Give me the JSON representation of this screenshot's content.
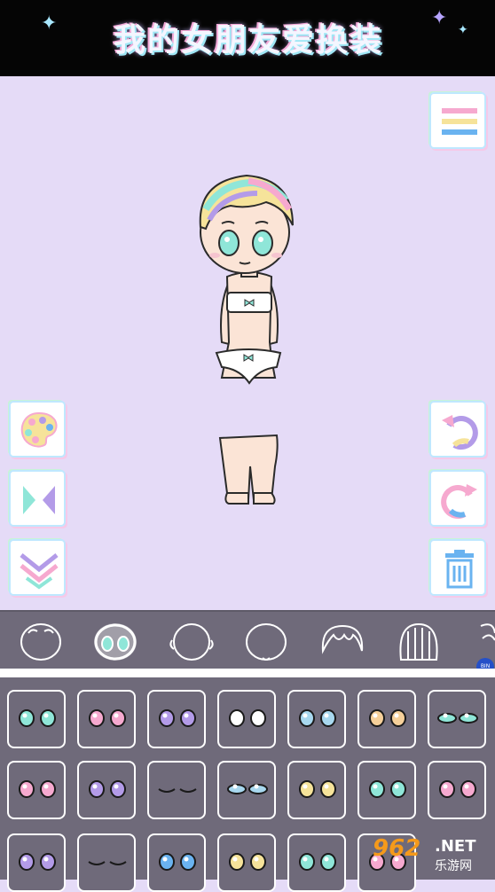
{
  "app": {
    "title": "我的女朋友爱换装"
  },
  "colors": {
    "header_bg": "#050505",
    "stage_bg": "#e5dbf7",
    "panel_bg": "#6f6a7a",
    "accent_cyan": "#8fe6d8",
    "accent_pink": "#f6a9cf",
    "accent_purple": "#b39be8"
  },
  "side_buttons_left": [
    {
      "name": "palette-button",
      "icon": "palette-icon"
    },
    {
      "name": "flip-button",
      "icon": "flip-icon"
    },
    {
      "name": "collapse-button",
      "icon": "chevron-down-double-icon"
    }
  ],
  "side_buttons_right": [
    {
      "name": "menu-button",
      "icon": "menu-icon"
    },
    {
      "name": "undo-button",
      "icon": "undo-icon"
    },
    {
      "name": "redo-button",
      "icon": "redo-icon"
    },
    {
      "name": "delete-button",
      "icon": "trash-icon"
    }
  ],
  "categories": [
    {
      "name": "face-shape",
      "selected": false
    },
    {
      "name": "eyes",
      "selected": true
    },
    {
      "name": "ears",
      "selected": false
    },
    {
      "name": "head",
      "selected": false
    },
    {
      "name": "hair-front",
      "selected": false
    },
    {
      "name": "hair-back",
      "selected": false
    },
    {
      "name": "more",
      "selected": false
    }
  ],
  "eye_options": [
    {
      "iris": "#8fe6d8",
      "style": "round"
    },
    {
      "iris": "#f6a9cf",
      "style": "sharp"
    },
    {
      "iris": "#b39be8",
      "style": "round"
    },
    {
      "iris": "#ffffff",
      "style": "oval"
    },
    {
      "iris": "#a8d8ef",
      "style": "lashes"
    },
    {
      "iris": "#f6d09a",
      "style": "star"
    },
    {
      "iris": "#8fe6d8",
      "style": "narrow"
    },
    {
      "iris": "#f6a9cf",
      "style": "round"
    },
    {
      "iris": "#b39be8",
      "style": "tear"
    },
    {
      "iris": "none",
      "style": "closed"
    },
    {
      "iris": "#a8d8ef",
      "style": "half"
    },
    {
      "iris": "#f6e39a",
      "style": "round"
    },
    {
      "iris": "#8fe6d8",
      "style": "round"
    },
    {
      "iris": "#f6a9cf",
      "style": "round"
    },
    {
      "iris": "#b39be8",
      "style": "round"
    },
    {
      "iris": "none",
      "style": "sleepy"
    },
    {
      "iris": "#6ab3f0",
      "style": "sparkle"
    },
    {
      "iris": "#f6e39a",
      "style": "round"
    },
    {
      "iris": "#8fe6d8",
      "style": "round"
    },
    {
      "iris": "#f6a9cf",
      "style": "round"
    }
  ],
  "watermark": {
    "number": "962",
    "suffix": ".NET",
    "site": "乐游网"
  },
  "badge": {
    "text": "BIN"
  }
}
